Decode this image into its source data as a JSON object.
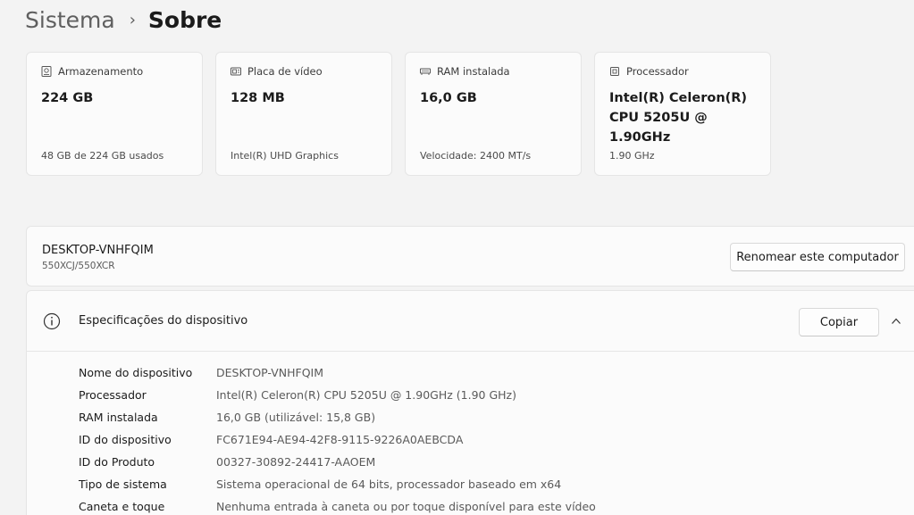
{
  "breadcrumb": {
    "parent": "Sistema",
    "separator": "›",
    "current": "Sobre"
  },
  "cards": [
    {
      "icon": "storage-icon",
      "title": "Armazenamento",
      "value": "224 GB",
      "sub": "48 GB de 224 GB usados"
    },
    {
      "icon": "gpu-icon",
      "title": "Placa de vídeo",
      "value": "128 MB",
      "sub": "Intel(R) UHD Graphics"
    },
    {
      "icon": "ram-icon",
      "title": "RAM instalada",
      "value": "16,0 GB",
      "sub": "Velocidade: 2400 MT/s"
    },
    {
      "icon": "processor-icon",
      "title": "Processador",
      "value": "Intel(R) Celeron(R) CPU 5205U @ 1.90GHz",
      "sub": "1.90 GHz"
    }
  ],
  "device": {
    "name": "DESKTOP-VNHFQIM",
    "model": "550XCJ/550XCR",
    "rename_label": "Renomear este computador"
  },
  "specs": {
    "title": "Especificações do dispositivo",
    "copy_label": "Copiar",
    "rows": [
      {
        "label": "Nome do dispositivo",
        "value": "DESKTOP-VNHFQIM"
      },
      {
        "label": "Processador",
        "value": "Intel(R) Celeron(R) CPU 5205U @ 1.90GHz (1.90 GHz)"
      },
      {
        "label": "RAM instalada",
        "value": "16,0 GB (utilizável: 15,8 GB)"
      },
      {
        "label": "ID do dispositivo",
        "value": "FC671E94-AE94-42F8-9115-9226A0AEBCDA"
      },
      {
        "label": "ID do Produto",
        "value": "00327-30892-24417-AAOEM"
      },
      {
        "label": "Tipo de sistema",
        "value": "Sistema operacional de 64 bits, processador baseado em x64"
      },
      {
        "label": "Caneta e toque",
        "value": "Nenhuma entrada à caneta ou por toque disponível para este vídeo"
      }
    ]
  },
  "colors": {
    "background": "#f3f3f3",
    "card": "#fbfbfb",
    "border": "#e5e5e5"
  }
}
